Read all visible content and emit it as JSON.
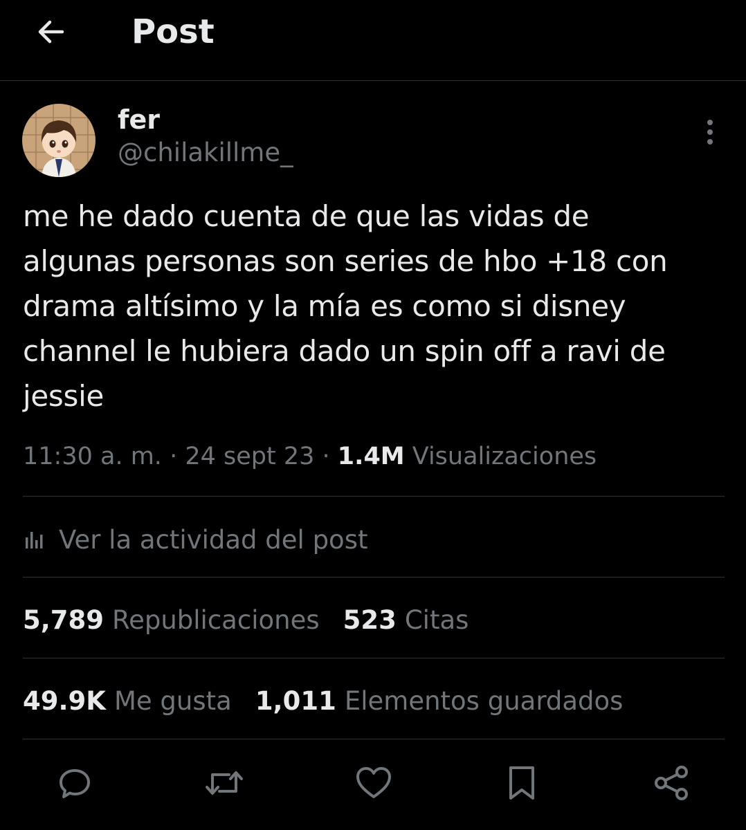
{
  "header": {
    "title": "Post",
    "back_icon": "arrow-left-icon"
  },
  "post": {
    "author": {
      "display_name": "fer",
      "handle": "@chilakillme_"
    },
    "text": "me he dado cuenta de que las vidas de\nalgunas personas son series de hbo +18 con\ndrama altísimo y la mía es como si disney\nchannel le hubiera dado un spin off a ravi de\njessie",
    "time": "11:30 a. m.",
    "separator": "·",
    "date": "24 sept 23",
    "views_count": "1.4M",
    "views_label": "Visualizaciones"
  },
  "activity": {
    "label": "Ver la actividad del post",
    "icon": "analytics-icon"
  },
  "stats": {
    "reposts_count": "5,789",
    "reposts_label": "Republicaciones",
    "quotes_count": "523",
    "quotes_label": "Citas",
    "likes_count": "49.9K",
    "likes_label": "Me gusta",
    "bookmarks_count": "1,011",
    "bookmarks_label": "Elementos guardados"
  },
  "actions": [
    "reply-icon",
    "repost-icon",
    "like-icon",
    "bookmark-icon",
    "share-icon"
  ],
  "colors": {
    "background": "#000000",
    "text_primary": "#e7e9ea",
    "text_secondary": "#71767b",
    "divider": "#2f3336"
  }
}
